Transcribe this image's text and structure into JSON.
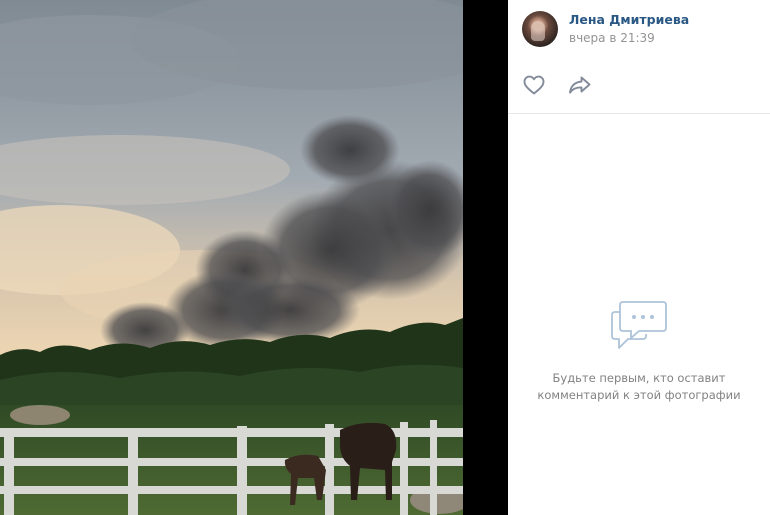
{
  "post": {
    "author_name": "Лена Дмитриева",
    "time": "вчера в 21:39"
  },
  "actions": {
    "like_icon": "heart-icon",
    "share_icon": "share-arrow-icon"
  },
  "comments": {
    "empty_line1": "Будьте первым, кто оставит",
    "empty_line2": "комментарий к этой фотографии",
    "icon": "comments-bubble-icon"
  },
  "colors": {
    "link": "#2a5885",
    "muted": "#939393",
    "icon": "#828a99",
    "empty_icon": "#aec3d9"
  }
}
